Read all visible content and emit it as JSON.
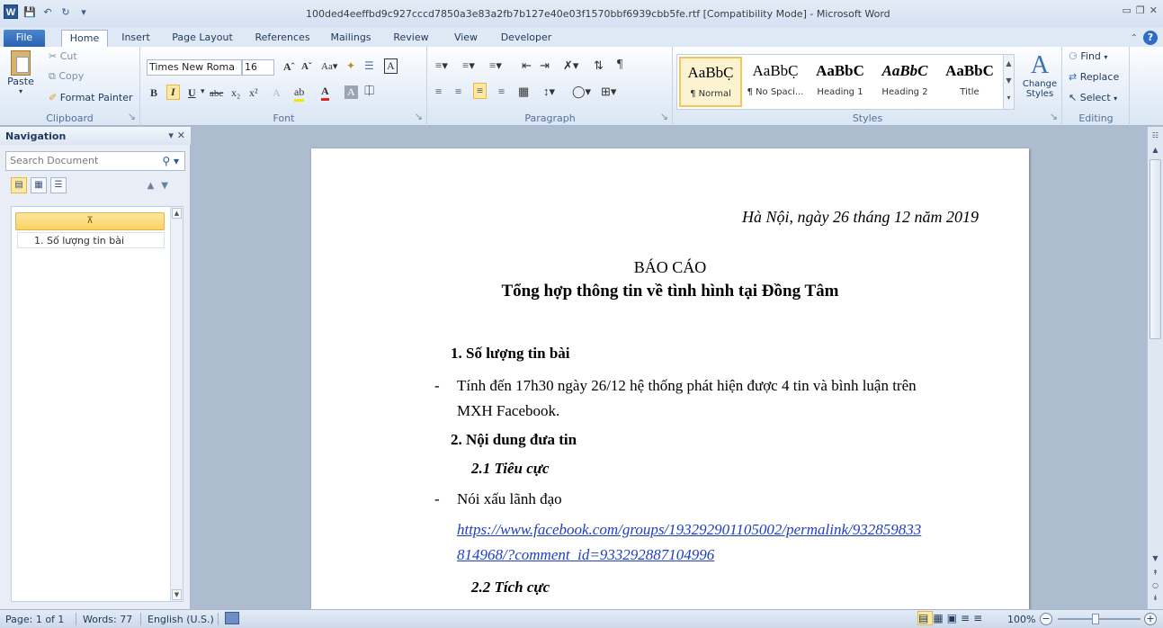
{
  "window": {
    "title": "100ded4eeffbd9c927cccd7850a3e83a2fb7b127e40e03f1570bbf6939cbb5fe.rtf [Compatibility Mode] - Microsoft Word",
    "app_icon": "W"
  },
  "tabs": [
    {
      "label": "File"
    },
    {
      "label": "Home"
    },
    {
      "label": "Insert"
    },
    {
      "label": "Page Layout"
    },
    {
      "label": "References"
    },
    {
      "label": "Mailings"
    },
    {
      "label": "Review"
    },
    {
      "label": "View"
    },
    {
      "label": "Developer"
    }
  ],
  "clipboard": {
    "paste": "Paste",
    "cut": "Cut",
    "copy": "Copy",
    "format_painter": "Format Painter",
    "label": "Clipboard"
  },
  "font": {
    "name": "Times New Roma",
    "size": "16",
    "label": "Font"
  },
  "paragraph": {
    "label": "Paragraph"
  },
  "styles": {
    "label": "Styles",
    "items": [
      {
        "sample": "AaBbC̣",
        "name": "¶ Normal"
      },
      {
        "sample": "AaBbC̣",
        "name": "¶ No Spaci..."
      },
      {
        "sample": "AaBbC",
        "name": "Heading 1"
      },
      {
        "sample": "AaBbC",
        "name": "Heading 2"
      },
      {
        "sample": "AaBbC",
        "name": "Title"
      }
    ],
    "change": "Change Styles"
  },
  "editing": {
    "label": "Editing",
    "find": "Find",
    "replace": "Replace",
    "select": "Select"
  },
  "nav": {
    "title": "Navigation",
    "search_placeholder": "Search Document",
    "items": [
      "1. Số lượng tin bài"
    ]
  },
  "document": {
    "date": "Hà Nội, ngày 26 tháng 12 năm 2019",
    "title1": "BÁO CÁO",
    "title2": "Tổng hợp thông tin về tình hình tại Đồng Tâm",
    "h1": "1.  Số lượng tin bài",
    "bullet_mark": "-",
    "b1_line1": "Tính đến 17h30 ngày 26/12 hệ thống phát hiện được 4 tin và bình luận trên",
    "b1_line2": "MXH Facebook.",
    "h2": "2.  Nội dung đưa tin",
    "h21": "2.1  Tiêu cực",
    "b2": "Nói xấu lãnh đạo",
    "link_line1": "https://www.facebook.com/groups/193292901105002/permalink/932859833",
    "link_line2": "814968/?comment_id=933292887104996",
    "h22": "2.2  Tích cực"
  },
  "status": {
    "page": "Page: 1 of 1",
    "words": "Words: 77",
    "language": "English (U.S.)",
    "zoom": "100%"
  }
}
